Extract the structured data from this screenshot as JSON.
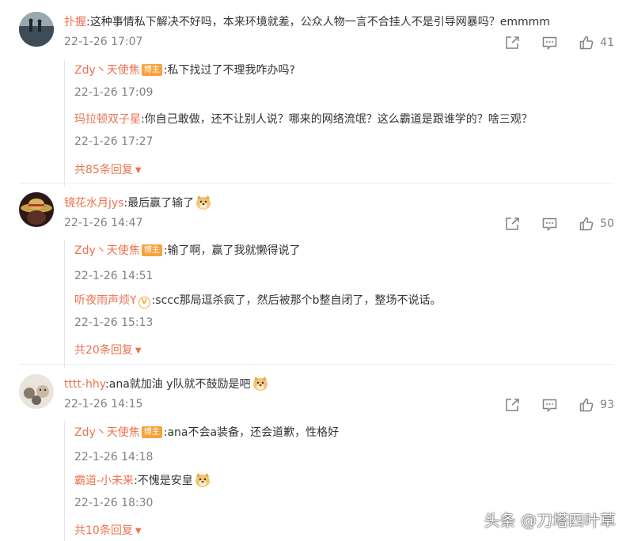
{
  "comments": [
    {
      "username": "扑握",
      "text": ":这种事情私下解决不好吗，本来环境就差，公众人物一言不合挂人不是引导网暴吗？emmmm",
      "time": "22-1-26 17:07",
      "likes": "41",
      "avatar": "avatar-lake-silhouettes",
      "replies": [
        {
          "username": "Zdy丶天使焦",
          "badge": "博主",
          "text": ":私下找过了不理我咋办吗?",
          "time": "22-1-26 17:09"
        },
        {
          "username": "玛拉顿双子星",
          "text": ":你自己敢做，还不让别人说？哪来的网络流氓？这么霸道是跟谁学的？啥三观？",
          "time": "22-1-26 17:27"
        }
      ],
      "more_label": "共85条回复"
    },
    {
      "username": "镜花水月jys",
      "text": ":最后赢了输了",
      "emoji": "doge-emoji",
      "time": "22-1-26 14:47",
      "likes": "50",
      "avatar": "avatar-straw-hat",
      "replies": [
        {
          "username": "Zdy丶天使焦",
          "badge": "博主",
          "text": ":输了啊，赢了我就懒得说了",
          "time": "22-1-26 14:51"
        },
        {
          "username": "听夜雨声烦Y",
          "verified": true,
          "text": ":sccc那局逗杀疯了，然后被那个b整自闭了，整场不说话。",
          "time": "22-1-26 15:13"
        }
      ],
      "more_label": "共20条回复"
    },
    {
      "username": "tttt-hhy",
      "text": ":ana就加油 y队就不鼓励是吧",
      "emoji": "doge-emoji",
      "time": "22-1-26 14:15",
      "likes": "93",
      "avatar": "avatar-cartoon-cats",
      "replies": [
        {
          "username": "Zdy丶天使焦",
          "badge": "博主",
          "text": ":ana不会a装备，还会道歉，性格好",
          "time": "22-1-26 14:18"
        },
        {
          "username": "霸道-小未来",
          "text": ":不愧是安皇",
          "emoji": "doge-emoji",
          "time": "22-1-26 18:30"
        }
      ],
      "more_label": "共10条回复"
    }
  ],
  "icons": {
    "share": "share-icon",
    "comment": "comment-icon",
    "like": "thumbs-up-icon"
  },
  "watermark": "头条 @刀塔四叶草",
  "colors": {
    "username": "#eb7350",
    "text": "#333333",
    "meta": "#808080",
    "badge": "#f9a23c"
  }
}
